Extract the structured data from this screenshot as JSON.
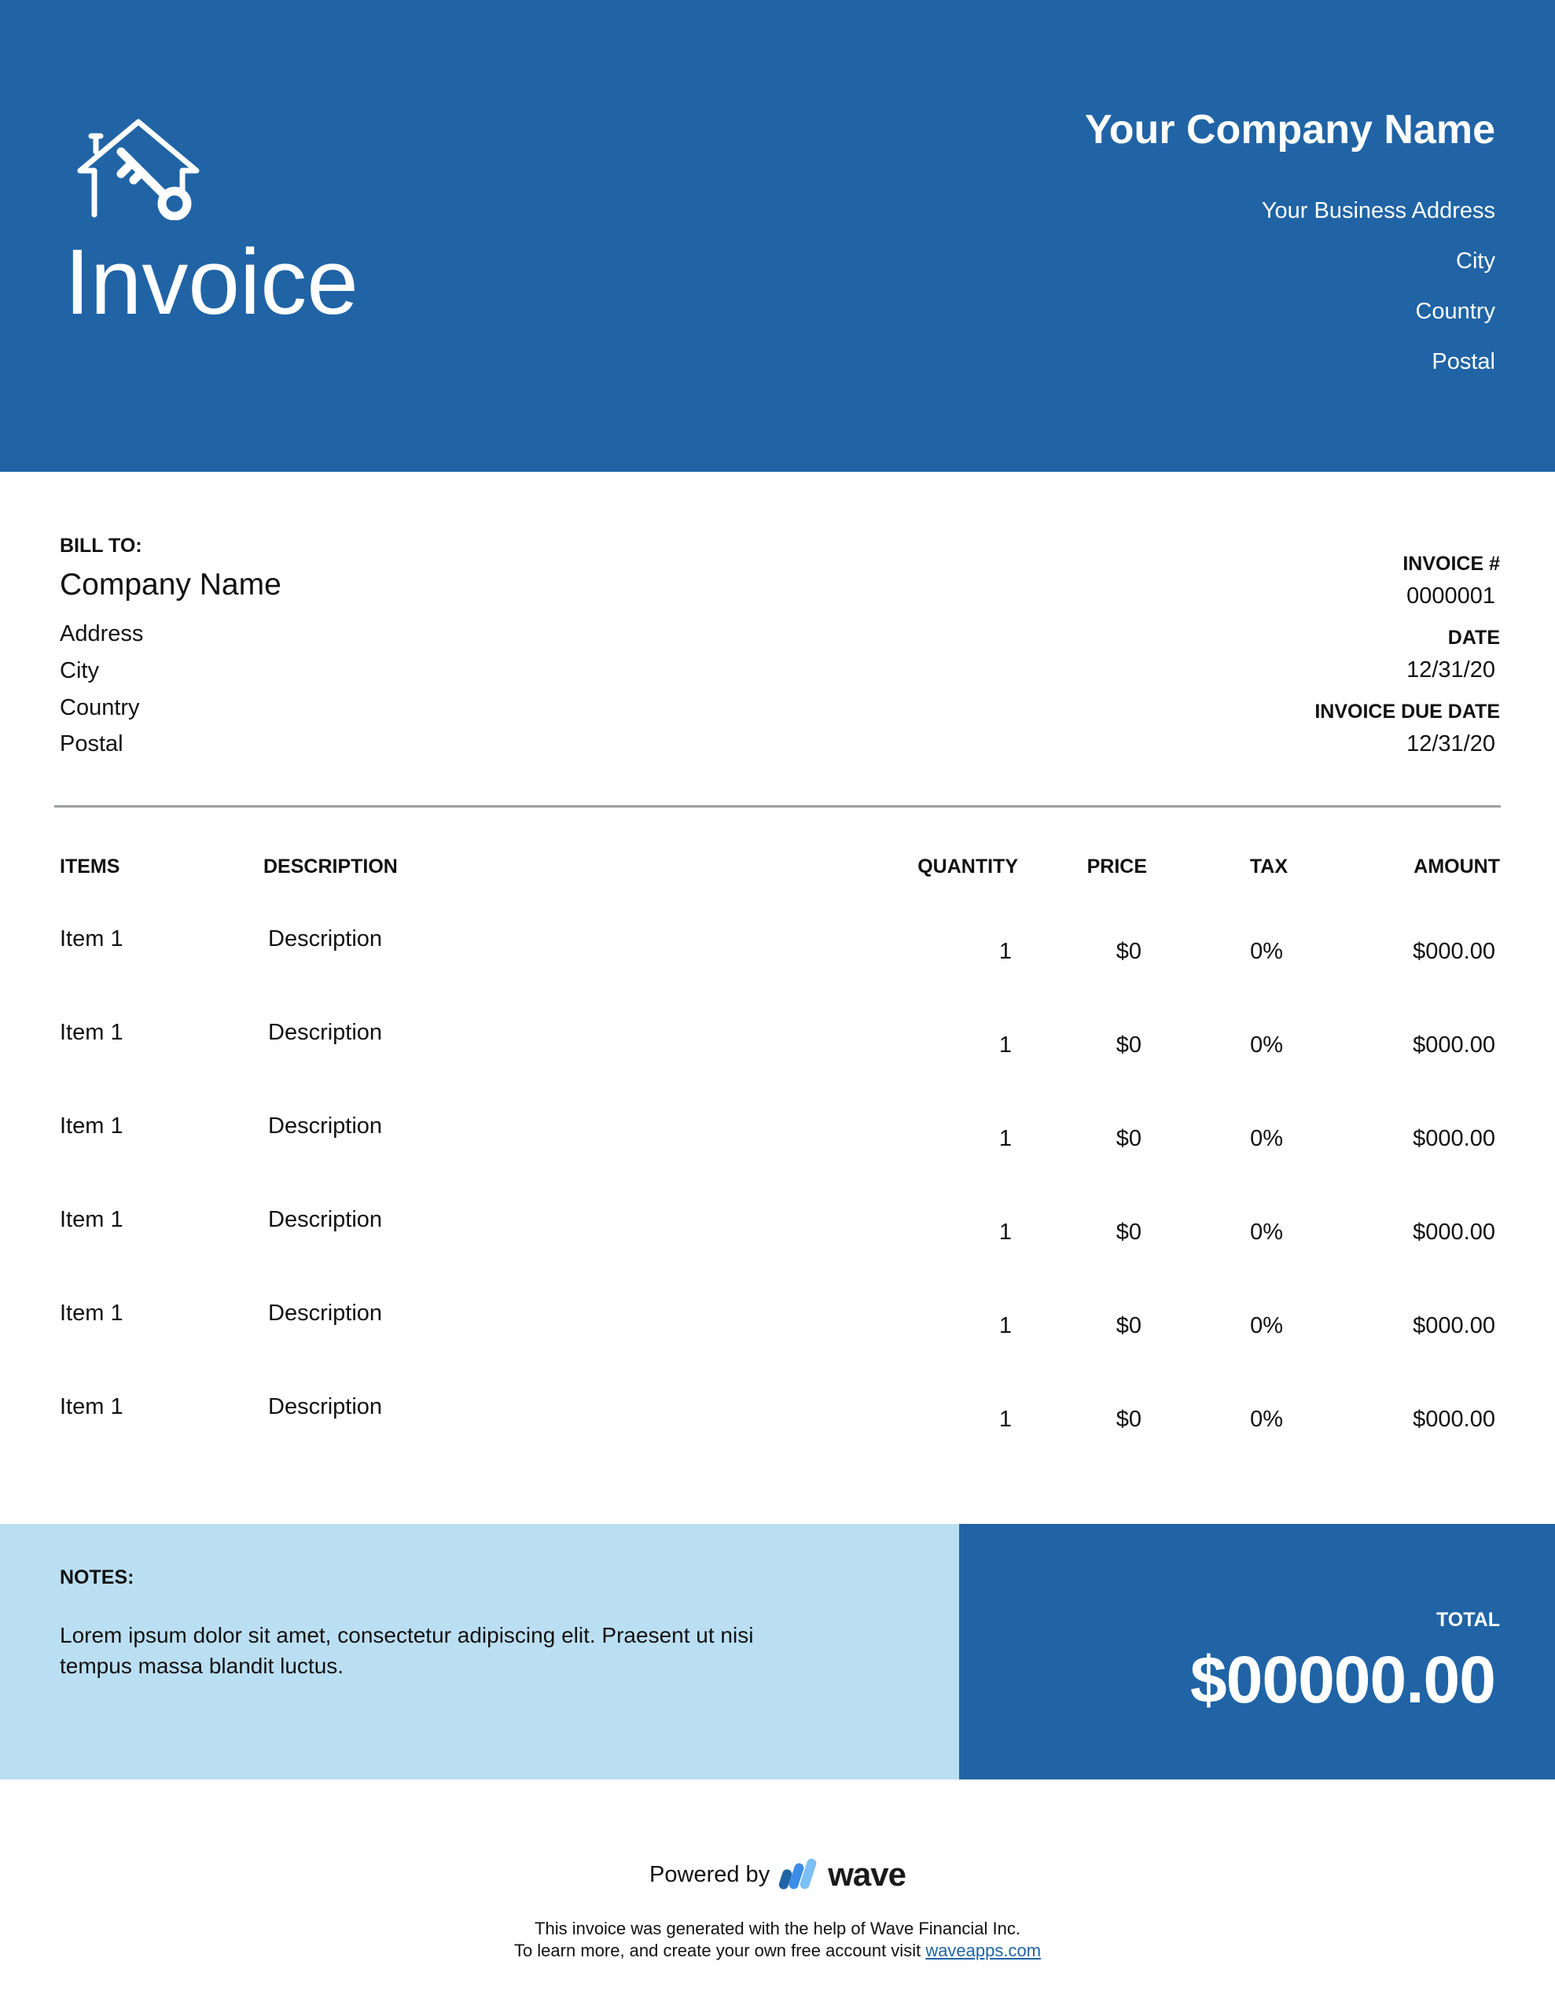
{
  "header": {
    "title": "Invoice",
    "logo_icon": "house-key-icon",
    "company_name": "Your Company Name",
    "company_address_lines": [
      "Your Business Address",
      "City",
      "Country",
      "Postal"
    ]
  },
  "bill_to": {
    "label": "BILL TO:",
    "company_name": "Company Name",
    "address_lines": [
      "Address",
      "City",
      "Country",
      "Postal"
    ]
  },
  "invoice_meta": {
    "invoice_number_label": "INVOICE #",
    "invoice_number": "0000001",
    "date_label": "DATE",
    "date": "12/31/20",
    "due_date_label": "INVOICE DUE DATE",
    "due_date": "12/31/20"
  },
  "table": {
    "headers": {
      "items": "ITEMS",
      "description": "DESCRIPTION",
      "quantity": "QUANTITY",
      "price": "PRICE",
      "tax": "TAX",
      "amount": "AMOUNT"
    },
    "rows": [
      {
        "item": "Item 1",
        "description": "Description",
        "quantity": "1",
        "price": "$0",
        "tax": "0%",
        "amount": "$000.00"
      },
      {
        "item": "Item 1",
        "description": "Description",
        "quantity": "1",
        "price": "$0",
        "tax": "0%",
        "amount": "$000.00"
      },
      {
        "item": "Item 1",
        "description": "Description",
        "quantity": "1",
        "price": "$0",
        "tax": "0%",
        "amount": "$000.00"
      },
      {
        "item": "Item 1",
        "description": "Description",
        "quantity": "1",
        "price": "$0",
        "tax": "0%",
        "amount": "$000.00"
      },
      {
        "item": "Item 1",
        "description": "Description",
        "quantity": "1",
        "price": "$0",
        "tax": "0%",
        "amount": "$000.00"
      },
      {
        "item": "Item 1",
        "description": "Description",
        "quantity": "1",
        "price": "$0",
        "tax": "0%",
        "amount": "$000.00"
      }
    ]
  },
  "notes": {
    "label": "NOTES:",
    "text": "Lorem ipsum dolor sit amet, consectetur adipiscing elit. Praesent ut nisi tempus massa blandit luctus."
  },
  "total": {
    "label": "TOTAL",
    "value": "$00000.00"
  },
  "footer": {
    "powered_by": "Powered by",
    "brand": "wave",
    "brand_icon": "wave-logo-icon",
    "line1": "This invoice was generated with the help of Wave Financial Inc.",
    "line2_prefix": "To learn more, and create your own free account visit ",
    "link_text": "waveapps.com"
  },
  "colors": {
    "brand_blue": "#2064a6",
    "notes_bg": "#bbdff2",
    "divider": "#9aa0a3"
  }
}
